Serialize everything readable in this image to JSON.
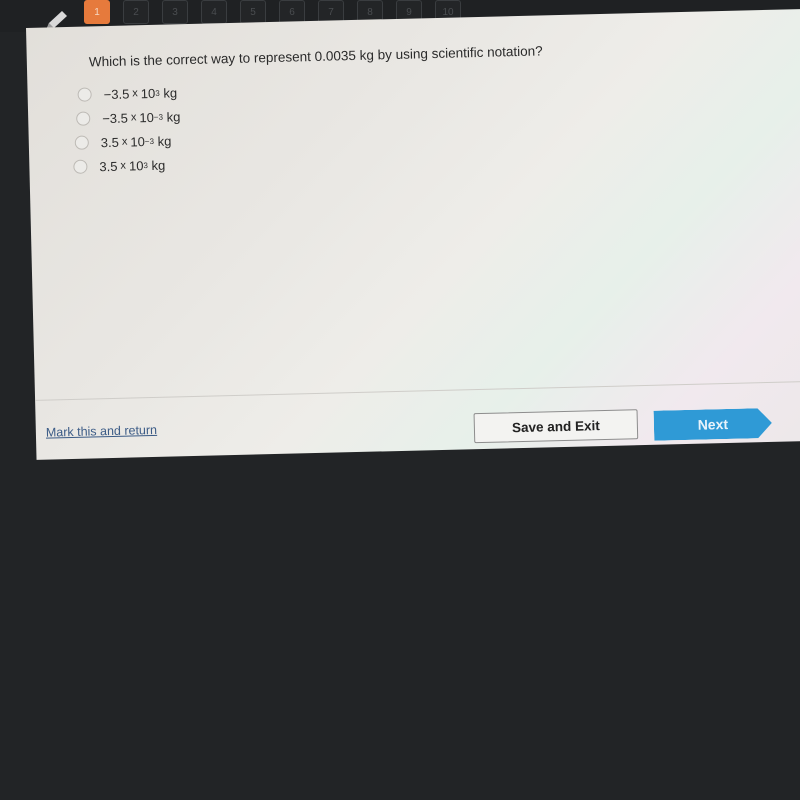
{
  "toolbar": {
    "question_numbers": [
      "1",
      "2",
      "3",
      "4",
      "5",
      "6",
      "7",
      "8",
      "9",
      "10"
    ],
    "active_question": "1"
  },
  "question": {
    "text": "Which is the correct way to represent 0.0035 kg by using scientific notation?",
    "options": [
      {
        "coefficient": "−3.5",
        "times": "x",
        "base": "10",
        "exponent": "3",
        "unit": "kg"
      },
      {
        "coefficient": "−3.5",
        "times": "x",
        "base": "10",
        "exponent": "−3",
        "unit": "kg"
      },
      {
        "coefficient": "3.5",
        "times": "x",
        "base": "10",
        "exponent": "−3",
        "unit": "kg"
      },
      {
        "coefficient": "3.5",
        "times": "x",
        "base": "10",
        "exponent": "3",
        "unit": "kg"
      }
    ]
  },
  "footer": {
    "mark_label": "Mark this and return",
    "save_label": "Save and Exit",
    "next_label": "Next"
  },
  "colors": {
    "active_question": "#e67a3c",
    "next_button": "#2f9ad6",
    "link": "#3b5b86"
  }
}
